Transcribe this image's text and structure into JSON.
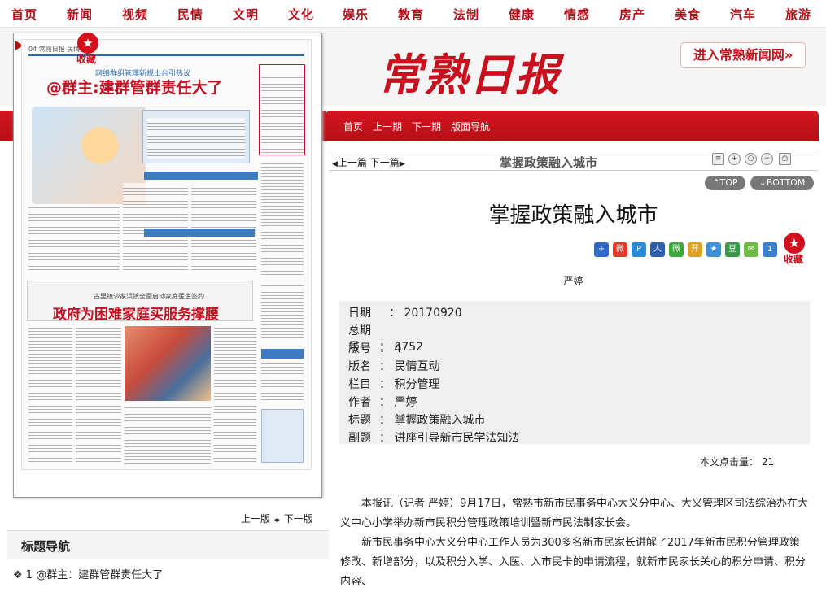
{
  "topnav": [
    "首页",
    "新闻",
    "视频",
    "民情",
    "文明",
    "文化",
    "娱乐",
    "教育",
    "法制",
    "健康",
    "情感",
    "房产",
    "美食",
    "汽车",
    "旅游"
  ],
  "header": {
    "masthead": "常熟日报",
    "enter_button": "进入常熟新闻网»"
  },
  "red_nav": [
    "首页",
    "上一期",
    "下一期",
    "版面导航"
  ],
  "paper": {
    "fav_label": "收藏",
    "page_header": "04 常熟日报 民情互动",
    "sub1": "网络群组管理新规出台引热议",
    "title1": "@群主:建群管群责任大了",
    "sub2": "古里镇沙家浜镇全面启动家庭医生签约",
    "title2": "政府为困难家庭买服务撑腰"
  },
  "pager": {
    "prev": "上一版",
    "next": "下一版"
  },
  "section": {
    "title": "标题导航",
    "items": [
      "1 @群主：建群管群责任大了"
    ]
  },
  "content": {
    "prev": "上一篇",
    "next": "下一篇",
    "bar_title": "掌握政策融入城市",
    "top_label": "TOP",
    "bottom_label": "BOTTOM",
    "fav_label": "收藏",
    "title": "掌握政策融入城市",
    "author": "严婷",
    "meta": [
      {
        "k": "日期",
        "v": "20170920"
      },
      {
        "k": "总期号",
        "v": "8752"
      },
      {
        "k": "版号",
        "v": "4"
      },
      {
        "k": "版名",
        "v": "民情互动"
      },
      {
        "k": "栏目",
        "v": "积分管理"
      },
      {
        "k": "作者",
        "v": "严婷"
      },
      {
        "k": "标题",
        "v": "掌握政策融入城市"
      },
      {
        "k": "副题",
        "v": "讲座引导新市民学法知法"
      }
    ],
    "clicks_label": "本文点击量：",
    "clicks": "21",
    "paragraphs": [
      "本报讯（记者 严婷）9月17日，常熟市新市民事务中心大义分中心、大义管理区司法综治办在大义中心小学举办新市民积分管理政策培训暨新市民法制家长会。",
      "新市民事务中心大义分中心工作人员为300多名新市民家长讲解了2017年新市民积分管理政策修改、新增部分，以及积分入学、入医、入市民卡的申请流程，就新市民家长关心的积分申请、积分内容、"
    ]
  }
}
